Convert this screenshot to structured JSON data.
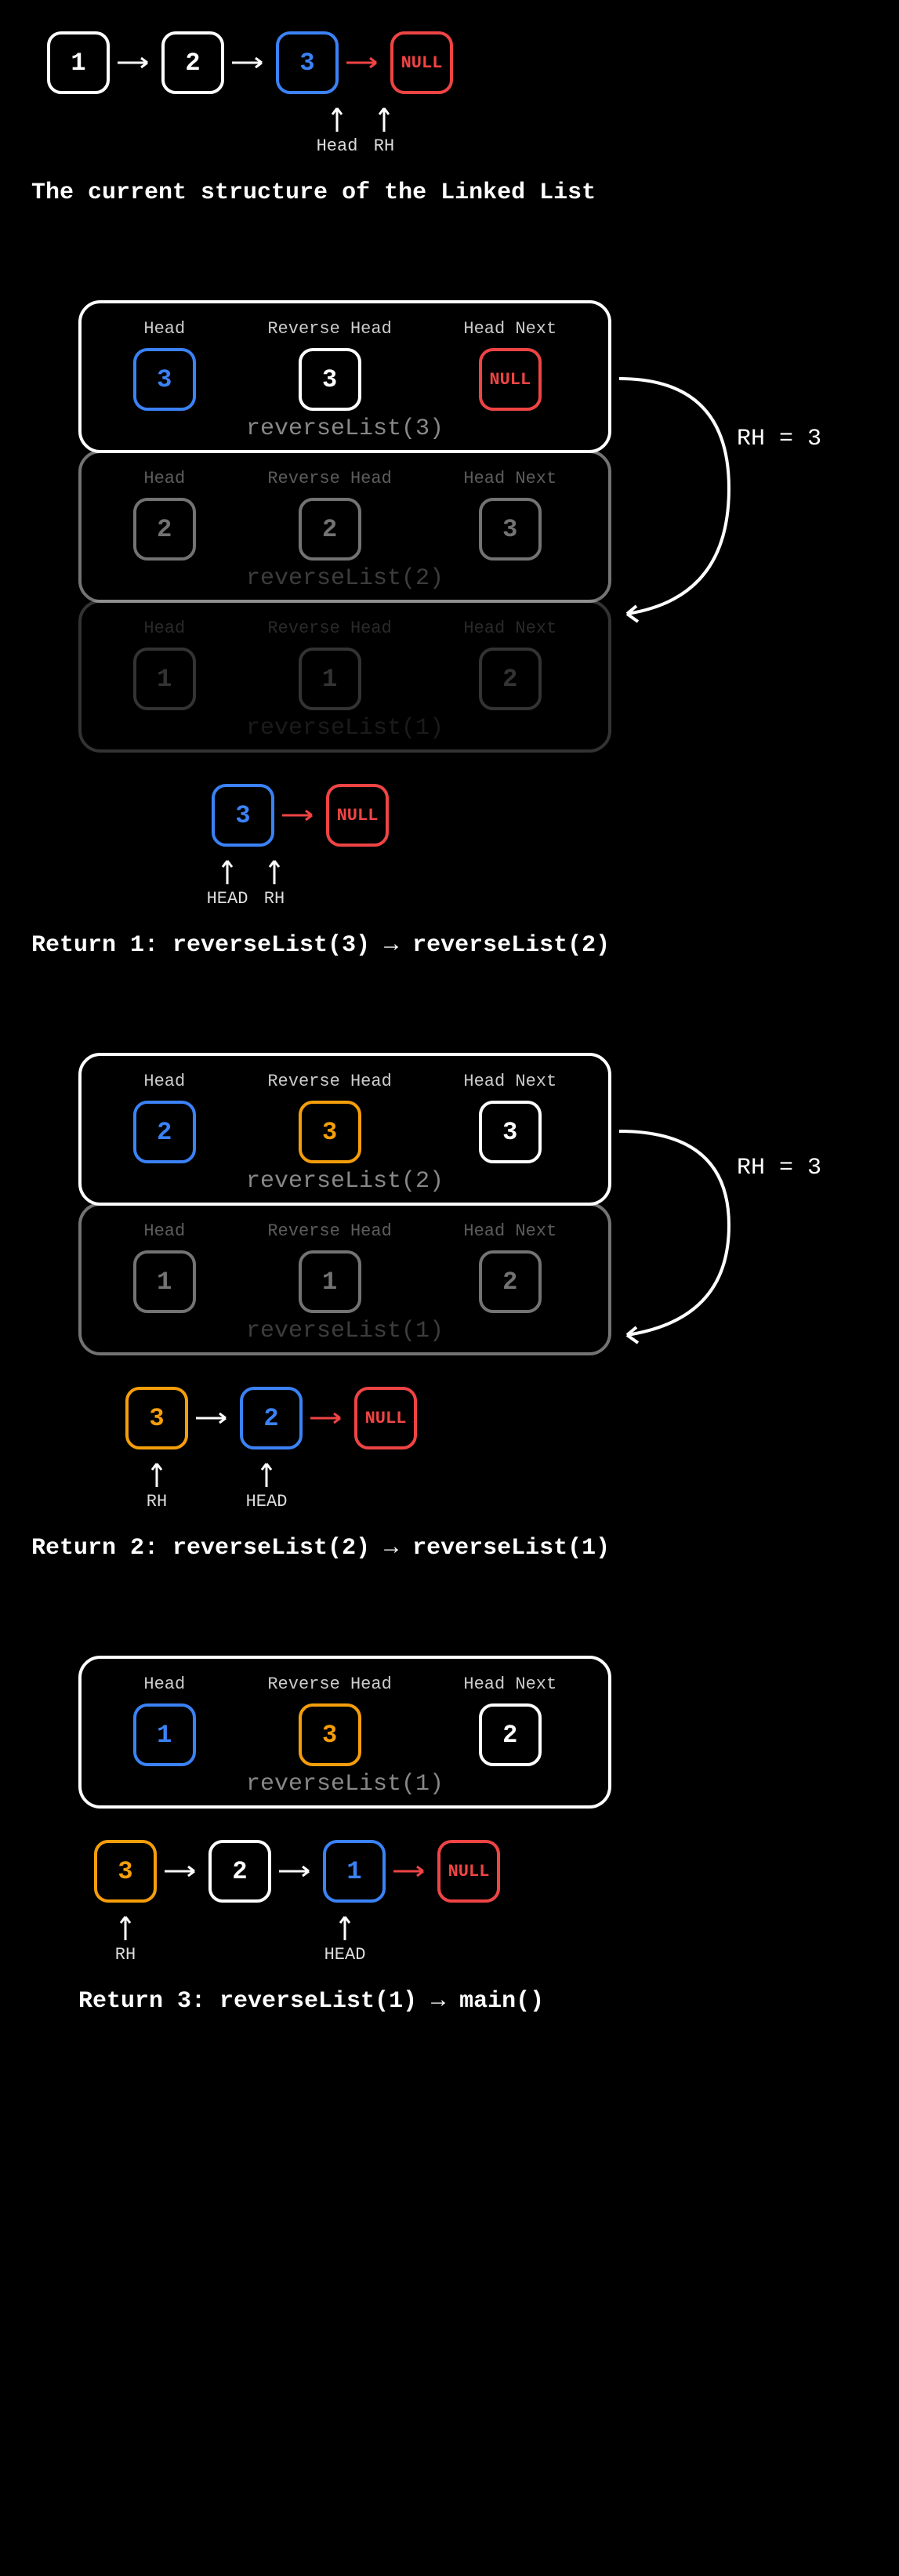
{
  "section1": {
    "nodes": [
      "1",
      "2",
      "3",
      "NULL"
    ],
    "pointers": {
      "head": "Head",
      "rh": "RH"
    },
    "caption": "The current structure of the Linked List"
  },
  "section2": {
    "frames": [
      {
        "title": "reverseList(3)",
        "cols": {
          "head_label": "Head",
          "rh_label": "Reverse Head",
          "hn_label": "Head Next"
        },
        "vals": {
          "head": "3",
          "rh": "3",
          "hn": "NULL"
        }
      },
      {
        "title": "reverseList(2)",
        "cols": {
          "head_label": "Head",
          "rh_label": "Reverse Head",
          "hn_label": "Head Next"
        },
        "vals": {
          "head": "2",
          "rh": "2",
          "hn": "3"
        }
      },
      {
        "title": "reverseList(1)",
        "cols": {
          "head_label": "Head",
          "rh_label": "Reverse Head",
          "hn_label": "Head Next"
        },
        "vals": {
          "head": "1",
          "rh": "1",
          "hn": "2"
        }
      }
    ],
    "side": "RH = 3",
    "mini": {
      "nodes": [
        "3",
        "NULL"
      ],
      "pointers": {
        "head": "HEAD",
        "rh": "RH"
      }
    },
    "caption": "Return 1: reverseList(3) → reverseList(2)"
  },
  "section3": {
    "frames": [
      {
        "title": "reverseList(2)",
        "cols": {
          "head_label": "Head",
          "rh_label": "Reverse Head",
          "hn_label": "Head Next"
        },
        "vals": {
          "head": "2",
          "rh": "3",
          "hn": "3"
        }
      },
      {
        "title": "reverseList(1)",
        "cols": {
          "head_label": "Head",
          "rh_label": "Reverse Head",
          "hn_label": "Head Next"
        },
        "vals": {
          "head": "1",
          "rh": "1",
          "hn": "2"
        }
      }
    ],
    "side": "RH = 3",
    "mini": {
      "nodes": [
        "3",
        "2",
        "NULL"
      ],
      "pointers": {
        "rh": "RH",
        "head": "HEAD"
      }
    },
    "caption": "Return 2: reverseList(2) → reverseList(1)"
  },
  "section4": {
    "frames": [
      {
        "title": "reverseList(1)",
        "cols": {
          "head_label": "Head",
          "rh_label": "Reverse Head",
          "hn_label": "Head Next"
        },
        "vals": {
          "head": "1",
          "rh": "3",
          "hn": "2"
        }
      }
    ],
    "mini": {
      "nodes": [
        "3",
        "2",
        "1",
        "NULL"
      ],
      "pointers": {
        "rh": "RH",
        "head": "HEAD"
      }
    },
    "caption": "Return 3: reverseList(1) → main()"
  }
}
